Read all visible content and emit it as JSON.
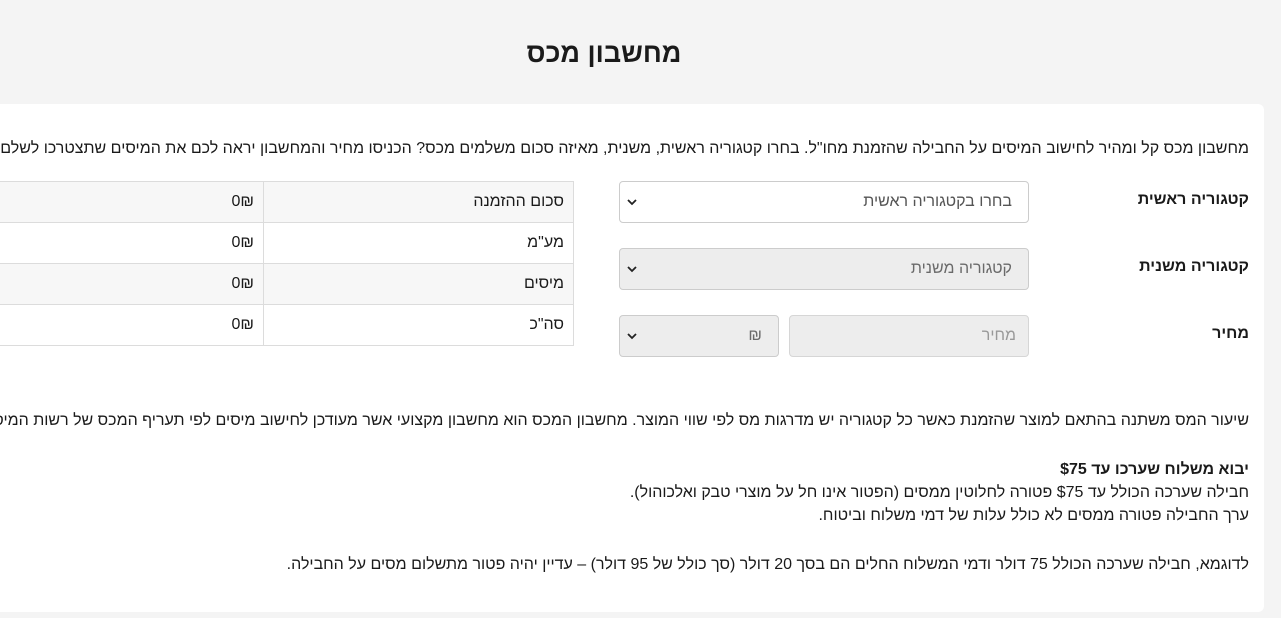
{
  "page": {
    "title": "מחשבון מכס"
  },
  "intro_text": "מחשבון מכס קל ומהיר לחישוב המיסים על החבילה שהזמנת מחו\"ל. בחרו קטגוריה ראשית, משנית, מאיזה סכום משלמים מכס? הכניסו מחיר והמחשבון יראה לכם את המיסים שתצטרכו לשלם.",
  "form": {
    "main_category": {
      "label": "קטגוריה ראשית",
      "selected": "בחרו בקטגוריה ראשית",
      "icon": "chevron-down-icon"
    },
    "sub_category": {
      "label": "קטגוריה משנית",
      "selected": "קטגוריה משנית",
      "icon": "chevron-down-icon"
    },
    "price": {
      "label": "מחיר",
      "placeholder": "מחיר",
      "currency_selected": "₪",
      "icon": "chevron-down-icon"
    }
  },
  "summary": {
    "rows": [
      {
        "label": "סכום ההזמנה",
        "value": "0₪"
      },
      {
        "label": "מע\"מ",
        "value": "0₪"
      },
      {
        "label": "מיסים",
        "value": "0₪"
      },
      {
        "label": "סה\"כ",
        "value": "0₪"
      }
    ]
  },
  "info": {
    "rate_text": "שיעור המס משתנה בהתאם למוצר שהזמנת כאשר כל קטגוריה יש מדרגות מס לפי שווי המוצר. מחשבון המכס הוא מחשבון מקצועי אשר מעודכן לחישוב מיסים לפי תעריף המכס של רשות המיסים.",
    "heading": "יבוא משלוח שערכו עד $75",
    "line1": "חבילה שערכה הכולל עד $75 פטורה לחלוטין ממסים (הפטור אינו חל על מוצרי טבק ואלכוהול).",
    "line2": "ערך החבילה פטורה ממסים לא כולל עלות של דמי משלוח וביטוח.",
    "example": "לדוגמא, חבילה שערכה הכולל 75 דולר ודמי המשלוח החלים הם בסך 20 דולר (סך כולל של 95 דולר) – עדיין יהיה פטור מתשלום מסים על החבילה."
  },
  "colors": {
    "page_bg": "#f4f4f4",
    "card_bg": "#ffffff",
    "disabled_field_bg": "#ededed",
    "border": "#cccccc"
  }
}
